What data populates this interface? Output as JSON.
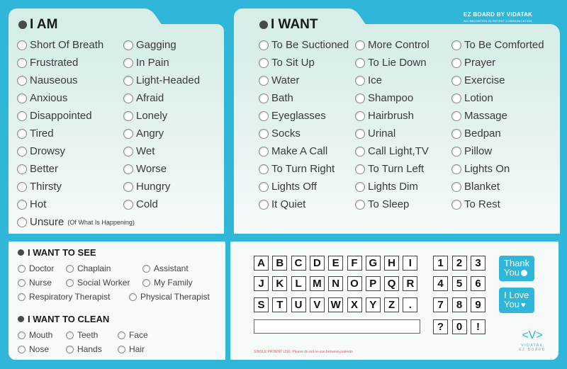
{
  "brand": {
    "title": "EZ BOARD BY VIDATAK",
    "tagline": "AN INNOVATION IN PATIENT COMMUNICATION"
  },
  "i_am": {
    "title": "I AM",
    "col1": [
      "Short Of Breath",
      "Frustrated",
      "Nauseous",
      "Anxious",
      "Disappointed",
      "Tired",
      "Drowsy",
      "Better",
      "Thirsty",
      "Hot"
    ],
    "col2": [
      "Gagging",
      "In Pain",
      "Light-Headed",
      "Afraid",
      "Lonely",
      "Angry",
      "Wet",
      "Worse",
      "Hungry",
      "Cold"
    ],
    "unsure": {
      "label": "Unsure",
      "note": "(Of What Is Happening)"
    }
  },
  "i_want": {
    "title": "I WANT",
    "col1": [
      "To Be Suctioned",
      "To Sit Up",
      "Water",
      "Bath",
      "Eyeglasses",
      "Socks",
      "Make A Call",
      "To Turn Right",
      "Lights Off",
      "It Quiet"
    ],
    "col2": [
      "More Control",
      "To Lie Down",
      "Ice",
      "Shampoo",
      "Hairbrush",
      "Urinal",
      "Call Light,TV",
      "To Turn Left",
      "Lights Dim",
      "To Sleep"
    ],
    "col3": [
      "To Be Comforted",
      "Prayer",
      "Exercise",
      "Lotion",
      "Massage",
      "Bedpan",
      "Pillow",
      "Lights On",
      "Blanket",
      "To Rest"
    ]
  },
  "i_want_to_see": {
    "title": "I WANT TO SEE",
    "items": [
      "Doctor",
      "Chaplain",
      "Assistant",
      "Nurse",
      "Social Worker",
      "My Family",
      "Respiratory Therapist",
      "Physical Therapist"
    ]
  },
  "i_want_to_clean": {
    "title": "I WANT TO CLEAN",
    "items": [
      "Mouth",
      "Teeth",
      "Face",
      "Nose",
      "Hands",
      "Hair"
    ]
  },
  "keyboard": {
    "rows": [
      [
        "A",
        "B",
        "C",
        "D",
        "E",
        "F",
        "G",
        "H",
        "I"
      ],
      [
        "J",
        "K",
        "L",
        "M",
        "N",
        "O",
        "P",
        "Q",
        "R"
      ],
      [
        "S",
        "T",
        "U",
        "V",
        "W",
        "X",
        "Y",
        "Z",
        "."
      ]
    ],
    "numbers": [
      [
        "1",
        "2",
        "3"
      ],
      [
        "4",
        "5",
        "6"
      ],
      [
        "7",
        "8",
        "9"
      ],
      [
        "?",
        "0",
        "!"
      ]
    ],
    "text_field_value": ""
  },
  "buttons": {
    "thank_you": [
      "Thank",
      "You"
    ],
    "i_love_you": [
      "I Love",
      "You"
    ]
  },
  "disclaimer": "SINGLE PATIENT USE. Please do not re-use between patients",
  "logo": {
    "name": "VIDATAK",
    "sub": "EZ BOARD"
  },
  "colors": {
    "brand": "#2fb6d8",
    "panel": "#d6ede8",
    "disclaimer": "#e05a6a"
  }
}
